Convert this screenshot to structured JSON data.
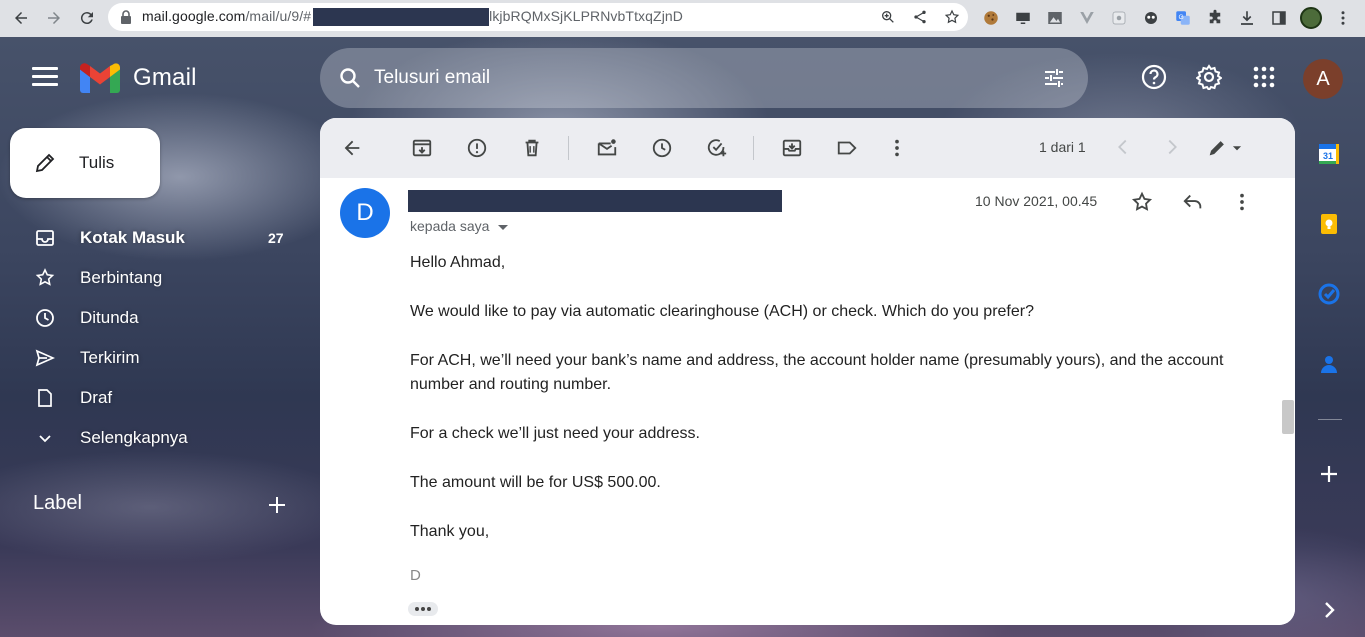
{
  "browser": {
    "url_host": "mail.google.com",
    "url_path": "/mail/u/9/#",
    "url_tail": "lkjbRQMxSjKLPRNvbTtxqZjnD"
  },
  "header": {
    "app_name": "Gmail",
    "search_placeholder": "Telusuri email",
    "avatar_initial": "A"
  },
  "sidebar": {
    "compose_label": "Tulis",
    "items": [
      {
        "label": "Kotak Masuk",
        "count": "27",
        "icon": "inbox-icon"
      },
      {
        "label": "Berbintang",
        "count": "",
        "icon": "star-icon"
      },
      {
        "label": "Ditunda",
        "count": "",
        "icon": "clock-icon"
      },
      {
        "label": "Terkirim",
        "count": "",
        "icon": "send-icon"
      },
      {
        "label": "Draf",
        "count": "",
        "icon": "draft-icon"
      },
      {
        "label": "Selengkapnya",
        "count": "",
        "icon": "chevron-down-icon"
      }
    ],
    "labels_heading": "Label"
  },
  "toolbar": {
    "pager_text": "1 dari 1"
  },
  "message": {
    "sender_initial": "D",
    "recipient_text": "kepada saya",
    "date": "10 Nov 2021, 00.45",
    "body": [
      "Hello Ahmad,",
      "We would like to pay via automatic clearinghouse (ACH) or check. Which do you prefer?",
      "For ACH, we’ll need your bank’s name and address, the account holder name (presumably yours), and the account number and routing number.",
      "For a check we’ll just need your address.",
      "The amount will be for US$ 500.00.",
      "Thank you,"
    ],
    "signature": "D"
  },
  "side_panel": {
    "calendar_day": "31"
  },
  "colors": {
    "accent_blue": "#1a73e8",
    "redaction": "#2c3650",
    "avatar_brown": "#7b3f2b"
  }
}
